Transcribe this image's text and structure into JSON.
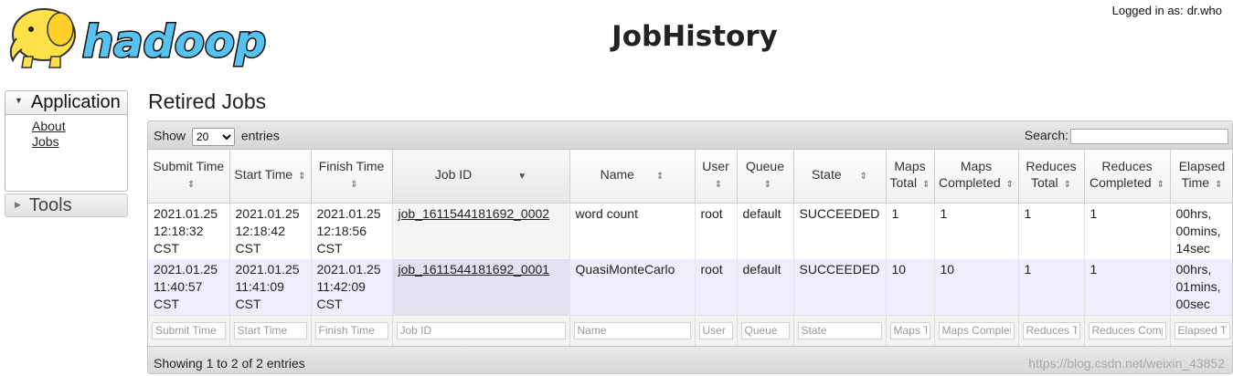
{
  "header": {
    "title": "JobHistory",
    "login_label": "Logged in as:",
    "login_user": "dr.who"
  },
  "sidebar": {
    "application": {
      "label": "Application",
      "links": [
        {
          "label": "About"
        },
        {
          "label": "Jobs"
        }
      ]
    },
    "tools": {
      "label": "Tools"
    }
  },
  "section_title": "Retired Jobs",
  "table_controls": {
    "show_label": "Show",
    "entries_value": "20",
    "entries_label": "entries",
    "search_label": "Search:",
    "info": "Showing 1 to 2 of 2 entries"
  },
  "columns": [
    {
      "label": "Submit Time"
    },
    {
      "label": "Start Time"
    },
    {
      "label": "Finish Time"
    },
    {
      "label": "Job ID"
    },
    {
      "label": "Name"
    },
    {
      "label": "User"
    },
    {
      "label": "Queue"
    },
    {
      "label": "State"
    },
    {
      "label": "Maps Total"
    },
    {
      "label": "Maps Completed"
    },
    {
      "label": "Reduces Total"
    },
    {
      "label": "Reduces Completed"
    },
    {
      "label": "Elapsed Time"
    }
  ],
  "rows": [
    {
      "submit": "2021.01.25 12:18:32 CST",
      "start": "2021.01.25 12:18:42 CST",
      "finish": "2021.01.25 12:18:56 CST",
      "job_id": "job_1611544181692_0002",
      "name": "word count",
      "user": "root",
      "queue": "default",
      "state": "SUCCEEDED",
      "maps_total": "1",
      "maps_completed": "1",
      "reduces_total": "1",
      "reduces_completed": "1",
      "elapsed": "00hrs, 00mins, 14sec"
    },
    {
      "submit": "2021.01.25 11:40:57 CST",
      "start": "2021.01.25 11:41:09 CST",
      "finish": "2021.01.25 11:42:09 CST",
      "job_id": "job_1611544181692_0001",
      "name": "QuasiMonteCarlo",
      "user": "root",
      "queue": "default",
      "state": "SUCCEEDED",
      "maps_total": "10",
      "maps_completed": "10",
      "reduces_total": "1",
      "reduces_completed": "1",
      "elapsed": "00hrs, 01mins, 00sec"
    }
  ],
  "filters": {
    "submit": "Submit Time",
    "start": "Start Time",
    "finish": "Finish Time",
    "job_id": "Job ID",
    "name": "Name",
    "user": "User",
    "queue": "Queue",
    "state": "State",
    "maps_total": "Maps Total",
    "maps_completed": "Maps Completed",
    "reduces_total": "Reduces Total",
    "reduces_completed": "Reduces Completed",
    "elapsed": "Elapsed Time"
  },
  "watermark": "https://blog.csdn.net/weixin_43852",
  "icons": {
    "logo": "hadoop-elephant-logo",
    "expand": "triangle-down-icon",
    "collapsed": "triangle-right-icon",
    "sort": "sort-both-icon",
    "sort_desc": "sort-desc-icon"
  }
}
